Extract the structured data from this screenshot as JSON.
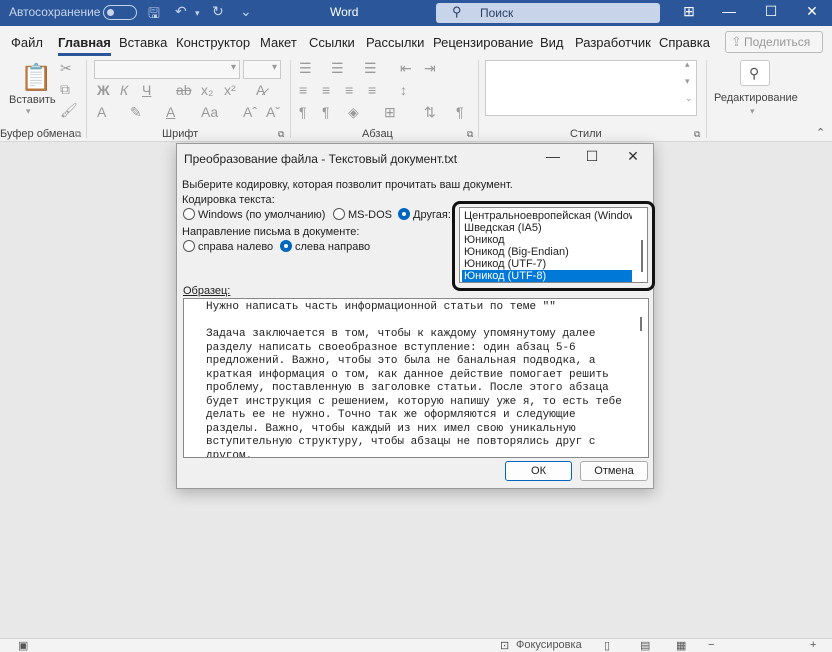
{
  "app": {
    "autosave_label": "Автосохранение",
    "title": "Word",
    "search_placeholder": "Поиск"
  },
  "tabs": [
    "Файл",
    "Главная",
    "Вставка",
    "Конструктор",
    "Макет",
    "Ссылки",
    "Рассылки",
    "Рецензирование",
    "Вид",
    "Разработчик",
    "Справка"
  ],
  "share_label": "Поделиться",
  "ribbon": {
    "clipboard_label": "Буфер обмена",
    "paste_label": "Вставить",
    "font_label": "Шрифт",
    "paragraph_label": "Абзац",
    "styles_label": "Стили",
    "editing_label": "Редактирование"
  },
  "status": {
    "focus_label": "Фокусировка"
  },
  "dialog": {
    "title": "Преобразование файла - Текстовый документ.txt",
    "prompt": "Выберите кодировку, которая позволит прочитать ваш документ.",
    "encoding_label": "Кодировка текста:",
    "enc_windows": "Windows (по умолчанию)",
    "enc_msdos": "MS-DOS",
    "enc_other": "Другая:",
    "direction_label": "Направление письма в документе:",
    "dir_rtl": "справа налево",
    "dir_ltr": "слева направо",
    "encodings": [
      "Центральноевропейская (Windows)",
      "Шведская (IA5)",
      "Юникод",
      "Юникод (Big-Endian)",
      "Юникод (UTF-7)",
      "Юникод (UTF-8)"
    ],
    "selected_encoding": "Юникод (UTF-8)",
    "sample_label": "Образец:",
    "sample_lines": [
      "Нужно написать часть информационной статьи по теме \"\"",
      "",
      "Задача заключается в том, чтобы к каждому упомянутому далее",
      "разделу написать своеобразное вступление: один абзац 5-6",
      "предложений. Важно, чтобы это была не банальная подводка, а",
      "краткая информация о том, как данное действие помогает решить",
      "проблему, поставленную в заголовке статьи. После этого абзаца",
      "будет инструкция с решением, которую напишу уже я, то есть тебе",
      "делать ее не нужно. Точно так же оформляются и следующие",
      "разделы. Важно, чтобы каждый из них имел свою уникальную",
      "вступительную структуру, чтобы абзацы не повторялись друг с",
      "другом."
    ],
    "ok_label": "ОК",
    "cancel_label": "Отмена"
  }
}
